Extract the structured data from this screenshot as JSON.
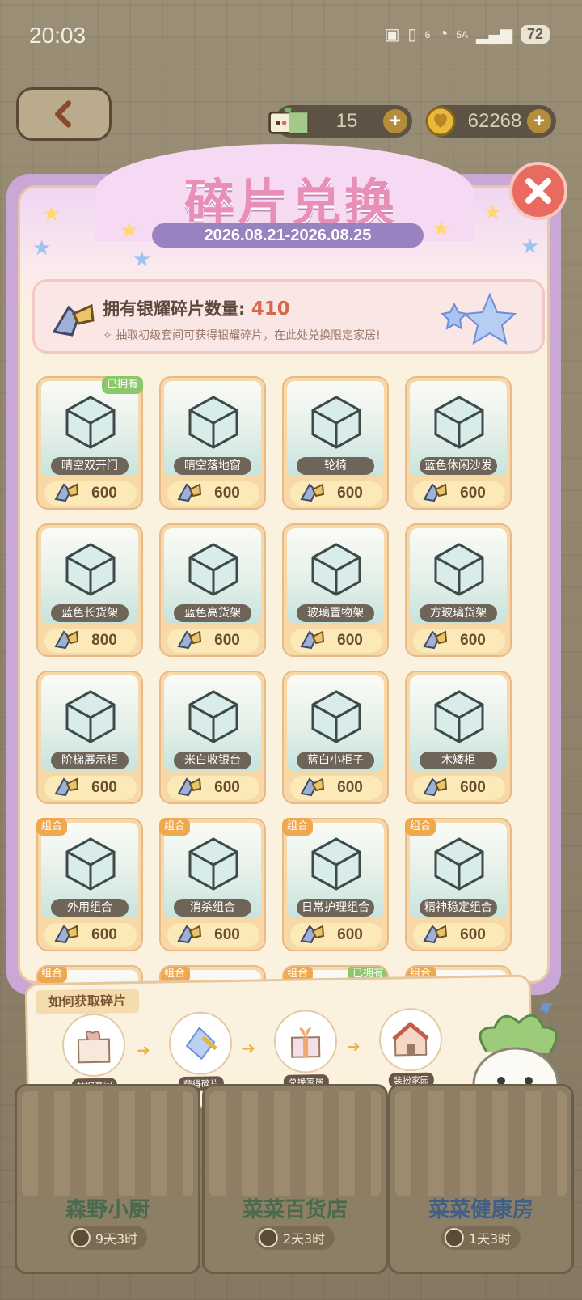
{
  "status": {
    "time": "20:03",
    "network": "5A",
    "wifi_sup": "6",
    "battery": "72"
  },
  "currency": {
    "tickets": "15",
    "coins": "62268"
  },
  "header": {
    "title": "碎片兑换",
    "date_range": "2026.08.21-2026.08.25"
  },
  "shards": {
    "label": "拥有银耀碎片数量:",
    "count": "410",
    "hint": "抽取初级套间可获得银耀碎片，在此处兑换限定家居!"
  },
  "badges": {
    "owned": "已拥有",
    "set": "组合"
  },
  "items": [
    {
      "name": "晴空双开门",
      "price": "600",
      "owned": true,
      "set": false
    },
    {
      "name": "晴空落地窗",
      "price": "600",
      "owned": false,
      "set": false
    },
    {
      "name": "轮椅",
      "price": "600",
      "owned": false,
      "set": false
    },
    {
      "name": "蓝色休闲沙发",
      "price": "600",
      "owned": false,
      "set": false
    },
    {
      "name": "蓝色长货架",
      "price": "800",
      "owned": false,
      "set": false
    },
    {
      "name": "蓝色高货架",
      "price": "600",
      "owned": false,
      "set": false
    },
    {
      "name": "玻璃置物架",
      "price": "600",
      "owned": false,
      "set": false
    },
    {
      "name": "方玻璃货架",
      "price": "600",
      "owned": false,
      "set": false
    },
    {
      "name": "阶梯展示柜",
      "price": "600",
      "owned": false,
      "set": false
    },
    {
      "name": "米白收银台",
      "price": "600",
      "owned": false,
      "set": false
    },
    {
      "name": "蓝白小柜子",
      "price": "600",
      "owned": false,
      "set": false
    },
    {
      "name": "木矮柜",
      "price": "600",
      "owned": false,
      "set": false
    },
    {
      "name": "外用组合",
      "price": "600",
      "owned": false,
      "set": true
    },
    {
      "name": "消杀组合",
      "price": "600",
      "owned": false,
      "set": true
    },
    {
      "name": "日常护理组合",
      "price": "600",
      "owned": false,
      "set": true
    },
    {
      "name": "精神稳定组合",
      "price": "600",
      "owned": false,
      "set": true
    }
  ],
  "partial_row": [
    {
      "set": true,
      "owned": false
    },
    {
      "set": true,
      "owned": false
    },
    {
      "set": true,
      "owned": true
    },
    {
      "set": true,
      "owned": false
    }
  ],
  "howto": {
    "title": "如何获取碎片",
    "steps": [
      "抽取套间",
      "获得碎片",
      "兑换家居",
      "装扮家园"
    ]
  },
  "shops": [
    {
      "name": "森野小厨",
      "timer": "9天3时"
    },
    {
      "name": "菜菜百货店",
      "timer": "2天3时"
    },
    {
      "name": "菜菜健康房",
      "timer": "1天3时"
    }
  ],
  "colors": {
    "accent_pink": "#e78fb6",
    "panel_purple": "#cba7d6",
    "price_text": "#6a4d30",
    "owned_green": "#8cc86b",
    "set_orange": "#f0a84f"
  }
}
